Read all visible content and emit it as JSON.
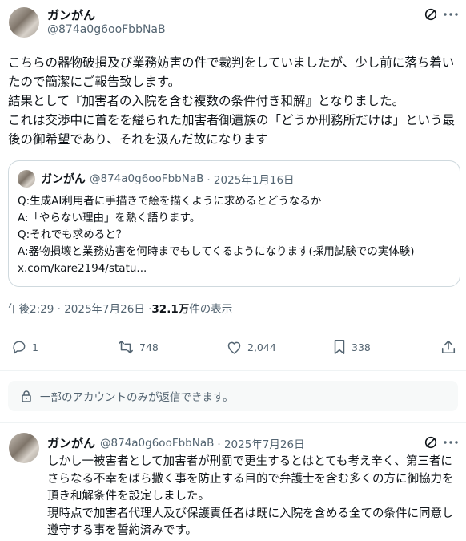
{
  "main_post": {
    "display_name": "ガンがん",
    "handle": "@874a0g6ooFbbNaB",
    "body": "こちらの器物破損及び業務妨害の件で裁判をしていましたが、少し前に落ち着いたので簡潔にご報告致します。\n結果として『加害者の入院を含む複数の条件付き和解』となりました。\nこれは交渉中に首をを縊られた加害者御遺族の「どうか刑務所だけは」という最後の御希望であり、それを汲んだ故になります",
    "quote": {
      "display_name": "ガンがん",
      "handle": "@874a0g6ooFbbNaB",
      "date": "· 2025年1月16日",
      "text": "Q:生成AI利用者に手描きで絵を描くように求めるとどうなるか\nA:「やらない理由」を熱く語ります。\nQ:それでも求めると？\nA:器物損壊と業務妨害を何時までもしてくるようになります(採用試験での実体験) x.com/kare2194/statu..."
    },
    "timestamp": "午後2:29 · 2025年7月26日 · ",
    "views_count": "32.1万",
    "views_label": " 件の表示",
    "actions": {
      "replies": "1",
      "reposts": "748",
      "likes": "2,044",
      "bookmarks": "338"
    }
  },
  "reply_notice": "一部のアカウントのみが返信できます。",
  "reply_post": {
    "display_name": "ガンがん",
    "handle": "@874a0g6ooFbbNaB",
    "date": "· 2025年7月26日",
    "body": "しかし一被害者として加害者が刑罰で更生するとはとても考え辛く、第三者にさらなる不幸をばら撒く事を防止する目的で弁護士を含む多くの方に御協力を頂き和解条件を設定しました。\n現時点で加害者代理人及び保護責任者は既に入院を含める全ての条件に同意し遵守する事を誓約済みです。"
  },
  "icons": [
    "grok-icon",
    "more-icon",
    "reply-icon",
    "repost-icon",
    "like-icon",
    "bookmark-icon",
    "share-icon",
    "lock-icon"
  ],
  "colors": {
    "text": "#0f1419",
    "muted": "#536471",
    "border": "#cfd9de",
    "notice_bg": "#f7f9f9"
  }
}
